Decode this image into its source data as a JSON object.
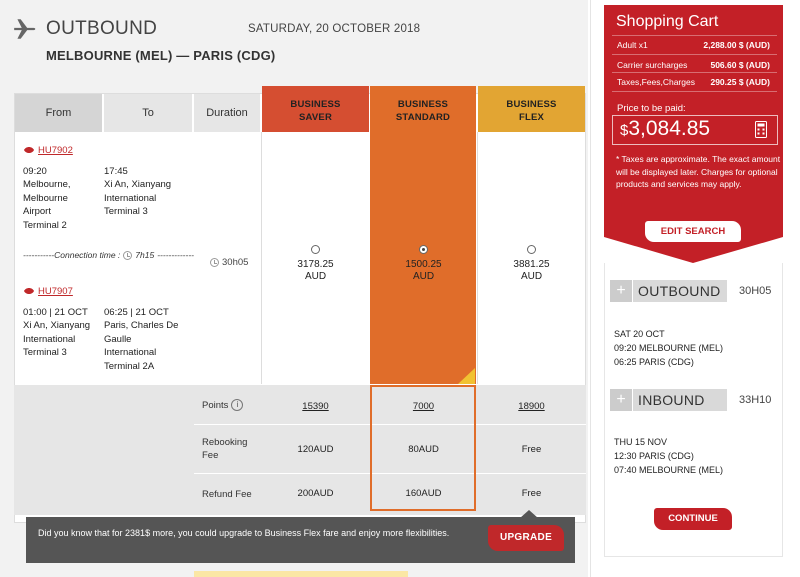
{
  "header": {
    "title": "OUTBOUND",
    "date": "SATURDAY, 20 OCTOBER 2018",
    "route": "MELBOURNE (MEL) — PARIS (CDG)"
  },
  "columns": {
    "from": "From",
    "to": "To",
    "duration": "Duration"
  },
  "fares": [
    {
      "line1": "BUSINESS",
      "line2": "SAVER",
      "price": "3178.25",
      "currency": "AUD",
      "points": "15390",
      "rebooking": "120AUD",
      "refund": "200AUD"
    },
    {
      "line1": "BUSINESS",
      "line2": "STANDARD",
      "price": "1500.25",
      "currency": "AUD",
      "points": "7000",
      "rebooking": "80AUD",
      "refund": "160AUD"
    },
    {
      "line1": "BUSINESS",
      "line2": "FLEX",
      "price": "3881.25",
      "currency": "AUD",
      "points": "18900",
      "rebooking": "Free",
      "refund": "Free"
    }
  ],
  "selected_fare": "BUSINESS STANDARD",
  "flights": [
    {
      "number": "HU7902",
      "dep_time": "09:20",
      "dep_place_lines": [
        "Melbourne,",
        "Melbourne",
        "Airport",
        "Terminal 2"
      ],
      "arr_time": "17:45",
      "arr_place_lines": [
        "Xi An, Xianyang",
        "International",
        "Terminal 3"
      ]
    },
    {
      "number": "HU7907",
      "dep_time": "01:00 | 21 OCT",
      "dep_place_lines": [
        "Xi An, Xianyang",
        "International",
        "Terminal 3"
      ],
      "arr_time": "06:25 | 21 OCT",
      "arr_place_lines": [
        "Paris, Charles De",
        "Gaulle",
        "International",
        "Terminal 2A"
      ]
    }
  ],
  "connection": {
    "label": "-----------Connection time :",
    "time": "7h15",
    "suffix": "-------------"
  },
  "total_duration": "30h05",
  "rows": {
    "points": "Points",
    "rebooking_line1": "Rebooking",
    "rebooking_line2": "Fee",
    "refund": "Refund Fee"
  },
  "upgrade": {
    "message": "Did you know that for 2381$ more, you could upgrade to Business Flex fare and enjoy more flexibilities.",
    "button": "UPGRADE"
  },
  "cart": {
    "title": "Shopping Cart",
    "lines": [
      {
        "label": "Adult x1",
        "value": "2,288.00 $ (AUD)"
      },
      {
        "label": "Carrier surcharges",
        "value": "506.60 $ (AUD)"
      },
      {
        "label": "Taxes,Fees,Charges",
        "value": "290.25 $ (AUD)"
      }
    ],
    "price_label": "Price to be paid:",
    "price_symbol": "$",
    "price_value": "3,084.85",
    "note": "* Taxes are approximate. The exact amount will be displayed later. Charges for optional products and services may apply.",
    "edit_button": "EDIT SEARCH"
  },
  "summary": {
    "outbound": {
      "title": "OUTBOUND",
      "duration": "30H05",
      "date": "SAT 20 OCT",
      "dep": "09:20 MELBOURNE (MEL)",
      "arr": "06:25 PARIS (CDG)"
    },
    "inbound": {
      "title": "INBOUND",
      "duration": "33H10",
      "date": "THU 15 NOV",
      "dep": "12:30 PARIS (CDG)",
      "arr": "07:40 MELBOURNE (MEL)"
    },
    "continue_button": "CONTINUE"
  },
  "colors": {
    "saver": "#d54e31",
    "standard": "#e06d2a",
    "flex": "#e2a533",
    "brand_red": "#c32027"
  },
  "icons": [
    "plane-icon",
    "airline-logo-icon",
    "clock-icon",
    "info-icon",
    "calculator-icon",
    "plus-icon"
  ]
}
